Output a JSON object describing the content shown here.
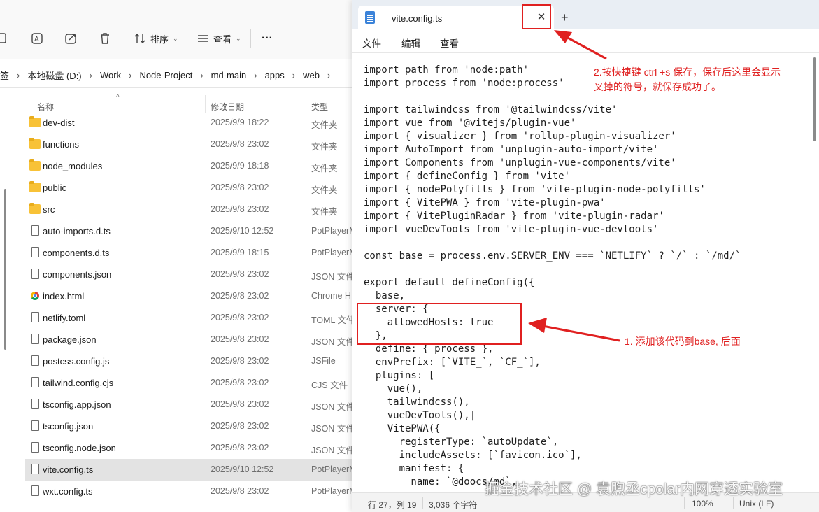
{
  "explorer": {
    "toolbar": {
      "sort_label": "排序",
      "view_label": "查看",
      "more_label": "···"
    },
    "address": {
      "crumbs": [
        "签",
        "本地磁盘 (D:)",
        "Work",
        "Node-Project",
        "md-main",
        "apps",
        "web"
      ]
    },
    "columns": {
      "name": "名称",
      "modified": "修改日期",
      "type": "类型"
    },
    "files": [
      {
        "name": "dev-dist",
        "date": "2025/9/9 18:22",
        "type": "文件夹",
        "kind": "folder"
      },
      {
        "name": "functions",
        "date": "2025/9/8 23:02",
        "type": "文件夹",
        "kind": "folder"
      },
      {
        "name": "node_modules",
        "date": "2025/9/9 18:18",
        "type": "文件夹",
        "kind": "folder"
      },
      {
        "name": "public",
        "date": "2025/9/8 23:02",
        "type": "文件夹",
        "kind": "folder"
      },
      {
        "name": "src",
        "date": "2025/9/8 23:02",
        "type": "文件夹",
        "kind": "folder"
      },
      {
        "name": "auto-imports.d.ts",
        "date": "2025/9/10 12:52",
        "type": "PotPlayerM",
        "kind": "file"
      },
      {
        "name": "components.d.ts",
        "date": "2025/9/9 18:15",
        "type": "PotPlayerM",
        "kind": "file"
      },
      {
        "name": "components.json",
        "date": "2025/9/8 23:02",
        "type": "JSON 文件",
        "kind": "file"
      },
      {
        "name": "index.html",
        "date": "2025/9/8 23:02",
        "type": "Chrome H",
        "kind": "chrome"
      },
      {
        "name": "netlify.toml",
        "date": "2025/9/8 23:02",
        "type": "TOML 文件",
        "kind": "file"
      },
      {
        "name": "package.json",
        "date": "2025/9/8 23:02",
        "type": "JSON 文件",
        "kind": "file"
      },
      {
        "name": "postcss.config.js",
        "date": "2025/9/8 23:02",
        "type": "JSFile",
        "kind": "file"
      },
      {
        "name": "tailwind.config.cjs",
        "date": "2025/9/8 23:02",
        "type": "CJS 文件",
        "kind": "file"
      },
      {
        "name": "tsconfig.app.json",
        "date": "2025/9/8 23:02",
        "type": "JSON 文件",
        "kind": "file"
      },
      {
        "name": "tsconfig.json",
        "date": "2025/9/8 23:02",
        "type": "JSON 文件",
        "kind": "file"
      },
      {
        "name": "tsconfig.node.json",
        "date": "2025/9/8 23:02",
        "type": "JSON 文件",
        "kind": "file"
      },
      {
        "name": "vite.config.ts",
        "date": "2025/9/10 12:52",
        "type": "PotPlayerM",
        "kind": "file",
        "selected": true
      },
      {
        "name": "wxt.config.ts",
        "date": "2025/9/8 23:02",
        "type": "PotPlayerM",
        "kind": "file"
      }
    ]
  },
  "notepad": {
    "tab_title": "vite.config.ts",
    "close_glyph": "✕",
    "add_glyph": "+",
    "menu": [
      "文件",
      "编辑",
      "查看"
    ],
    "code_lines": [
      "import path from 'node:path'",
      "import process from 'node:process'",
      "",
      "import tailwindcss from '@tailwindcss/vite'",
      "import vue from '@vitejs/plugin-vue'",
      "import { visualizer } from 'rollup-plugin-visualizer'",
      "import AutoImport from 'unplugin-auto-import/vite'",
      "import Components from 'unplugin-vue-components/vite'",
      "import { defineConfig } from 'vite'",
      "import { nodePolyfills } from 'vite-plugin-node-polyfills'",
      "import { VitePWA } from 'vite-plugin-pwa'",
      "import { VitePluginRadar } from 'vite-plugin-radar'",
      "import vueDevTools from 'vite-plugin-vue-devtools'",
      "",
      "const base = process.env.SERVER_ENV === `NETLIFY` ? `/` : `/md/`",
      "",
      "export default defineConfig({",
      "  base,",
      "  server: {",
      "    allowedHosts: true",
      "  },",
      "  define: { process },",
      "  envPrefix: [`VITE_`, `CF_`],",
      "  plugins: [",
      "    vue(),",
      "    tailwindcss(),",
      "    vueDevTools(),|",
      "    VitePWA({",
      "      registerType: `autoUpdate`,",
      "      includeAssets: [`favicon.ico`],",
      "      manifest: {",
      "        name: `@doocs/md`,"
    ],
    "status": {
      "position": "行 27，列 19",
      "chars": "3,036 个字符",
      "zoom": "100%",
      "eol": "Unix (LF)"
    }
  },
  "annotations": {
    "note_save": [
      "2.按快捷键 ctrl +s 保存，保存后这里会显示",
      "叉掉的符号，就保存成功了。"
    ],
    "note_add": "1. 添加该代码到base, 后面",
    "color": "#e02020"
  },
  "watermark": "掘金技术社区 @ 袁煦丞cpolar内网穿透实验室"
}
